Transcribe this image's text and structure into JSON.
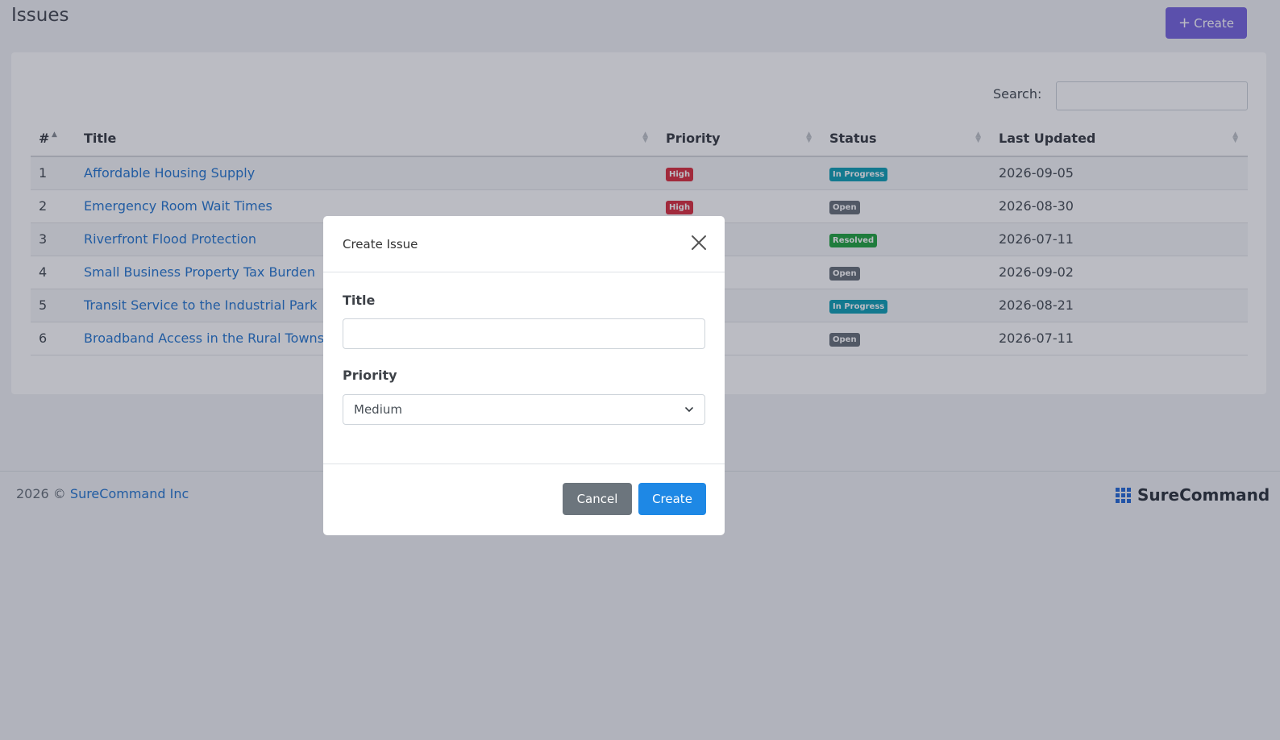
{
  "page": {
    "title": "Issues",
    "create_button": "Create",
    "create_icon": "plus-icon"
  },
  "search": {
    "label": "Search:",
    "value": ""
  },
  "table": {
    "columns": [
      "#",
      "Title",
      "Priority",
      "Status",
      "Last Updated"
    ],
    "rows": [
      {
        "num": "1",
        "title": "Affordable Housing Supply",
        "priority": "High",
        "status": "In Progress",
        "updated": "2026-09-05"
      },
      {
        "num": "2",
        "title": "Emergency Room Wait Times",
        "priority": "High",
        "status": "Open",
        "updated": "2026-08-30"
      },
      {
        "num": "3",
        "title": "Riverfront Flood Protection",
        "priority": "",
        "status": "Resolved",
        "updated": "2026-07-11"
      },
      {
        "num": "4",
        "title": "Small Business Property Tax Burden",
        "priority": "",
        "status": "Open",
        "updated": "2026-09-02"
      },
      {
        "num": "5",
        "title": "Transit Service to the Industrial Park",
        "priority": "",
        "status": "In Progress",
        "updated": "2026-08-21"
      },
      {
        "num": "6",
        "title": "Broadband Access in the Rural Townsh",
        "priority": "",
        "status": "Open",
        "updated": "2026-07-11"
      }
    ]
  },
  "status_colors": {
    "High": "#dc3545",
    "In Progress": "#17a2b8",
    "Open": "#6c757d",
    "Resolved": "#28a745"
  },
  "footer": {
    "copyright": "2026 ©",
    "company": "SureCommand Inc",
    "brand": "SureCommand"
  },
  "modal": {
    "title": "Create Issue",
    "title_label": "Title",
    "title_value": "",
    "priority_label": "Priority",
    "priority_value": "Medium",
    "cancel": "Cancel",
    "submit": "Create"
  }
}
